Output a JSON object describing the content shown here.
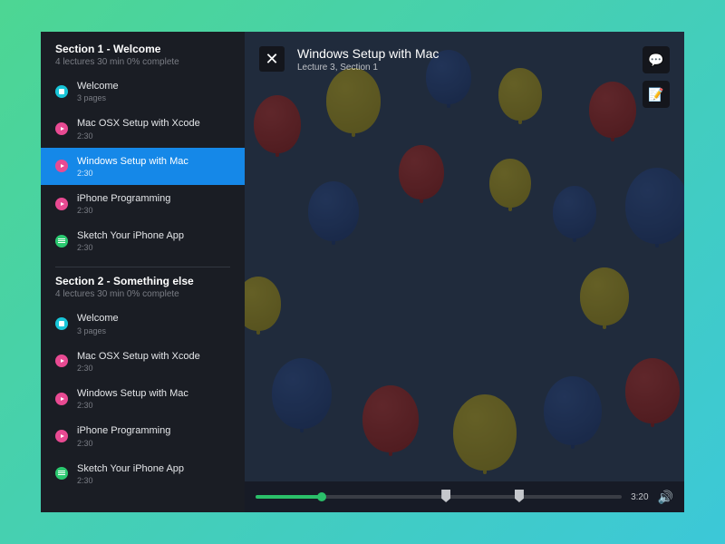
{
  "sidebar": {
    "sections": [
      {
        "title": "Section 1 - Welcome",
        "meta": "4 lectures   30 min   0% complete",
        "items": [
          {
            "title": "Welcome",
            "sub": "3 pages",
            "iconColor": "cyan",
            "iconType": "doc",
            "active": false
          },
          {
            "title": "Mac OSX Setup with Xcode",
            "sub": "2:30",
            "iconColor": "pink",
            "iconType": "play",
            "active": false
          },
          {
            "title": "Windows Setup with Mac",
            "sub": "2:30",
            "iconColor": "pink",
            "iconType": "play",
            "active": true
          },
          {
            "title": "iPhone Programming",
            "sub": "2:30",
            "iconColor": "pink",
            "iconType": "play",
            "active": false
          },
          {
            "title": "Sketch Your iPhone App",
            "sub": "2:30",
            "iconColor": "green",
            "iconType": "lines",
            "active": false
          }
        ]
      },
      {
        "title": "Section 2 - Something else",
        "meta": "4 lectures   30 min   0% complete",
        "items": [
          {
            "title": "Welcome",
            "sub": "3 pages",
            "iconColor": "cyan",
            "iconType": "doc",
            "active": false
          },
          {
            "title": "Mac OSX Setup with Xcode",
            "sub": "2:30",
            "iconColor": "pink",
            "iconType": "play",
            "active": false
          },
          {
            "title": "Windows Setup with Mac",
            "sub": "2:30",
            "iconColor": "pink",
            "iconType": "play",
            "active": false
          },
          {
            "title": "iPhone Programming",
            "sub": "2:30",
            "iconColor": "pink",
            "iconType": "play",
            "active": false
          },
          {
            "title": "Sketch Your iPhone App",
            "sub": "2:30",
            "iconColor": "green",
            "iconType": "lines",
            "active": false
          }
        ]
      }
    ]
  },
  "main": {
    "close": "✕",
    "title": "Windows Setup with Mac",
    "subtitle": "Lecture 3, Section 1",
    "chat_icon": "💬",
    "notes_icon": "📝"
  },
  "controls": {
    "progress_pct": 18,
    "markers_pct": [
      52,
      72
    ],
    "time": "3:20",
    "volume_icon": "🔊"
  }
}
